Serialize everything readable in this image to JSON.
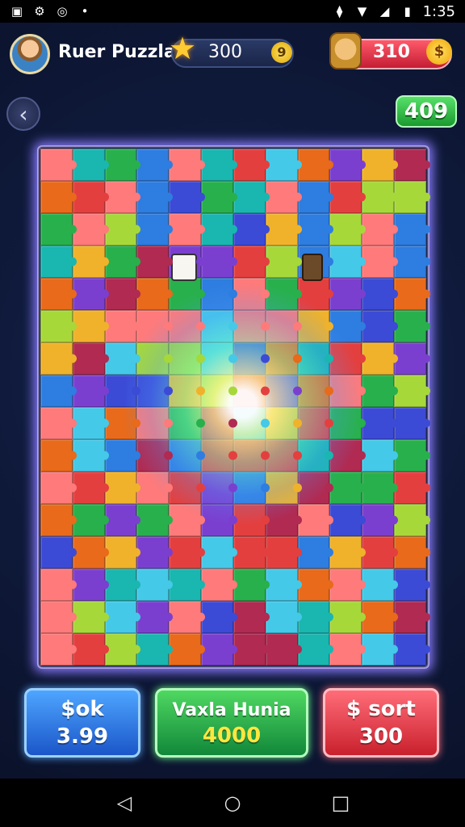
{
  "status_bar": {
    "time": "1:35",
    "left_icons": [
      "image-icon",
      "settings-icon",
      "sync-icon",
      "dot-icon"
    ],
    "right_icons": [
      "vibrate-icon",
      "wifi-icon",
      "signal-icon",
      "battery-icon"
    ]
  },
  "header": {
    "title": "Ruer Puzzla",
    "stars_value": "300",
    "coin_small_symbol": "9",
    "rival_value": "310",
    "coin_big_symbol": "$"
  },
  "score": {
    "value": "409"
  },
  "board": {
    "columns": 12,
    "rows": 16
  },
  "palette": [
    "#e43f3f",
    "#28b04c",
    "#2e7de0",
    "#f0b22b",
    "#7b3fd0",
    "#ff7a7a",
    "#1ab6b0",
    "#e86a1a",
    "#3b4bd6",
    "#b02a52",
    "#44c9e8",
    "#a6d83a"
  ],
  "buttons": {
    "blue": {
      "label": "$ok",
      "value": "3.99"
    },
    "green": {
      "label": "Vaxla Hunia",
      "value": "4000"
    },
    "red": {
      "label": "$ sort",
      "value": "300"
    }
  },
  "nav": {
    "back": "◁",
    "home": "○",
    "recents": "□"
  },
  "accent_colors": {
    "blue": "#2e7de0",
    "green": "#28b04c",
    "red": "#e43f3f"
  }
}
